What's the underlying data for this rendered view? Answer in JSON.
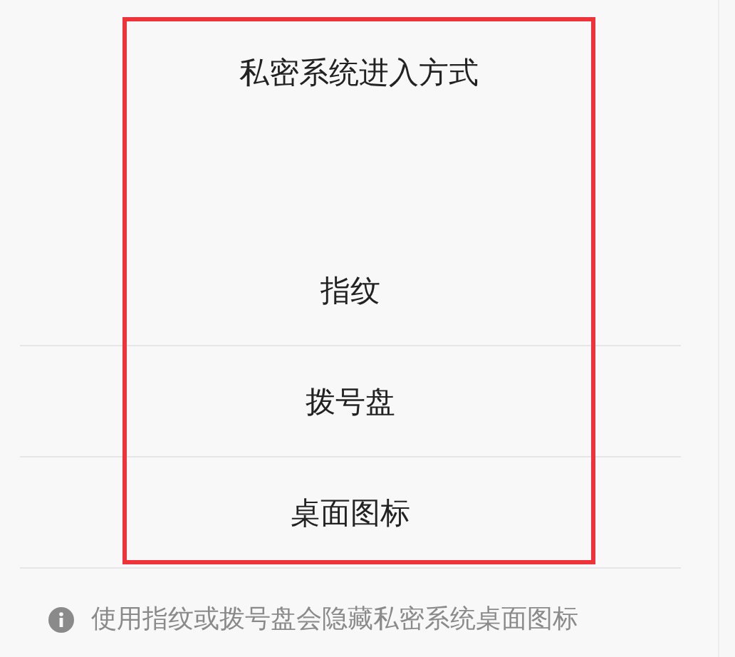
{
  "dialog": {
    "title": "私密系统进入方式",
    "options": [
      {
        "label": "指纹"
      },
      {
        "label": "拨号盘"
      },
      {
        "label": "桌面图标"
      }
    ]
  },
  "footer_note": "使用指纹或拨号盘会隐藏私密系统桌面图标"
}
